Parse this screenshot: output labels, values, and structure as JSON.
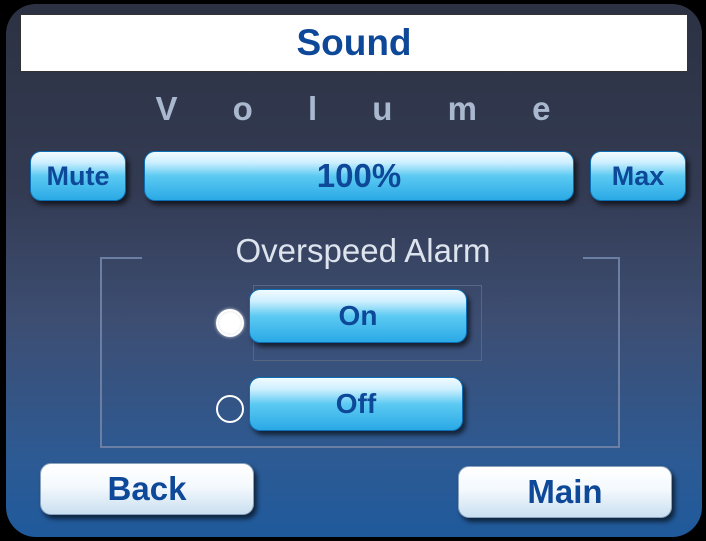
{
  "title": "Sound",
  "volume": {
    "label": "V o l u m e",
    "mute_label": "Mute",
    "level_text": "100%",
    "max_label": "Max",
    "level": 1.0
  },
  "alarm": {
    "title": "Overspeed Alarm",
    "on_label": "On",
    "off_label": "Off",
    "selected": "On"
  },
  "nav": {
    "back_label": "Back",
    "main_label": "Main"
  },
  "colors": {
    "accent_text": "#0e4898",
    "button_blue": "#2aa9e6"
  }
}
